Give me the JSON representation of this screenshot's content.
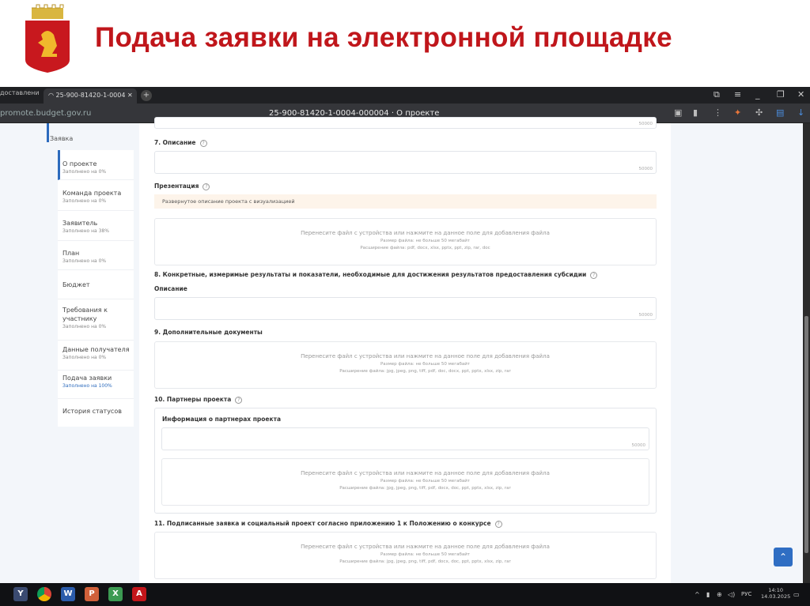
{
  "slide": {
    "title": "Подача заявки на электронной площадке",
    "emblem": "Krasnoyarsk coat of arms"
  },
  "browser": {
    "prev_tab": "доставлени",
    "active_tab": "25-900-81420-1-0004",
    "url": "promote.budget.gov.ru",
    "page_title": "25-900-81420-1-0004-000004 · О проекте"
  },
  "sidebar": {
    "header": "Заявка",
    "items": [
      {
        "label": "О проекте",
        "status": "Заполнено на 0%"
      },
      {
        "label": "Команда проекта",
        "status": "Заполнено на 0%"
      },
      {
        "label": "Заявитель",
        "status": "Заполнено на 38%"
      },
      {
        "label": "План",
        "status": "Заполнено на 0%"
      },
      {
        "label": "Бюджет",
        "status": ""
      },
      {
        "label": "Требования к участнику",
        "status": "Заполнено на 0%"
      },
      {
        "label": "Данные получателя",
        "status": "Заполнено на 0%"
      },
      {
        "label": "Подача заявки",
        "status": "Заполнено на 100%"
      },
      {
        "label": "История статусов",
        "status": ""
      }
    ]
  },
  "form": {
    "counter": "50000",
    "help": "?",
    "s7_label": "7. Описание",
    "presentation_label": "Презентация",
    "presentation_hint": "Развернутое описание проекта с визуализацией",
    "s8_label": "8. Конкретные, измеримые результаты и показатели, необходимые для достижения результатов предоставления субсидии",
    "s8_desc_label": "Описание",
    "s9_label": "9. Дополнительные документы",
    "s10_label": "10. Партнеры проекта",
    "s10_info_label": "Информация о партнерах проекта",
    "s11_label": "11. Подписанные заявка и социальный проект согласно приложению 1 к Положению о конкурсе",
    "drop_text": "Перенесите файл с устройства или нажмите на данное поле для добавления файла",
    "drop_size": "Размер файла: не больше 50 мегабайт",
    "drop_ext_presentation": "Расширение файла: pdf, docx, xlsx, pptx, ppt, zip, rar, doc",
    "drop_ext_docs": "Расширение файла: jpg, jpeg, png, tiff, pdf, doc, docx, ppt, pptx, xlsx, zip, rar",
    "drop_ext_other": "Расширение файла: jpg, jpeg, png, tiff, pdf, docx, doc, ppt, pptx, xlsx, zip, rar"
  },
  "taskbar": {
    "lang": "РУС",
    "time": "14:10",
    "date": "14.03.2025"
  },
  "colors": {
    "title": "#c0161b",
    "accent": "#2d6bbd"
  }
}
